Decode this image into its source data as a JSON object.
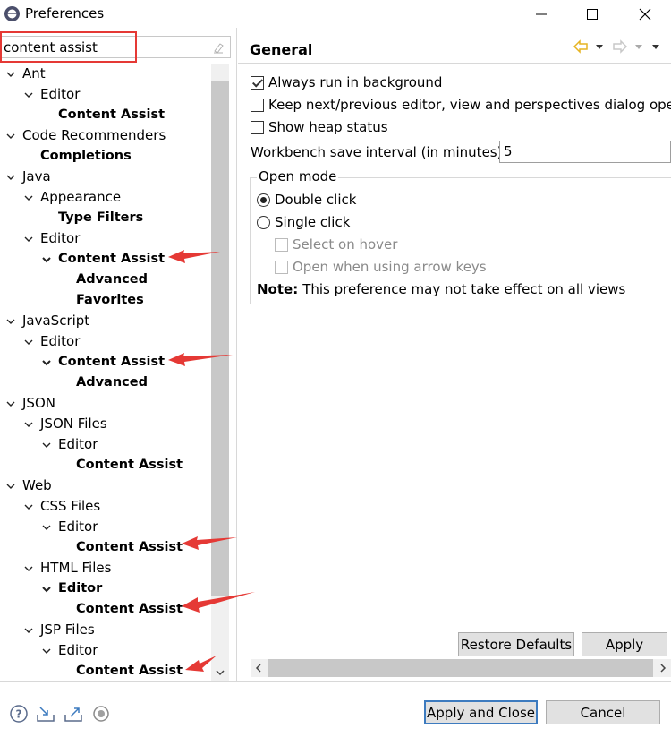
{
  "window": {
    "title": "Preferences"
  },
  "filter": {
    "value": "content assist"
  },
  "tree": [
    {
      "label": "Ant",
      "level": 0,
      "expanded": true,
      "bold": false
    },
    {
      "label": "Editor",
      "level": 1,
      "expanded": true,
      "bold": false
    },
    {
      "label": "Content Assist",
      "level": 2,
      "expanded": null,
      "bold": true
    },
    {
      "label": "Code Recommenders",
      "level": 0,
      "expanded": true,
      "bold": false
    },
    {
      "label": "Completions",
      "level": 1,
      "expanded": null,
      "bold": true
    },
    {
      "label": "Java",
      "level": 0,
      "expanded": true,
      "bold": false
    },
    {
      "label": "Appearance",
      "level": 1,
      "expanded": true,
      "bold": false
    },
    {
      "label": "Type Filters",
      "level": 2,
      "expanded": null,
      "bold": true
    },
    {
      "label": "Editor",
      "level": 1,
      "expanded": true,
      "bold": false
    },
    {
      "label": "Content Assist",
      "level": 2,
      "expanded": true,
      "bold": true
    },
    {
      "label": "Advanced",
      "level": 3,
      "expanded": null,
      "bold": true
    },
    {
      "label": "Favorites",
      "level": 3,
      "expanded": null,
      "bold": true
    },
    {
      "label": "JavaScript",
      "level": 0,
      "expanded": true,
      "bold": false
    },
    {
      "label": "Editor",
      "level": 1,
      "expanded": true,
      "bold": false
    },
    {
      "label": "Content Assist",
      "level": 2,
      "expanded": true,
      "bold": true
    },
    {
      "label": "Advanced",
      "level": 3,
      "expanded": null,
      "bold": true
    },
    {
      "label": "JSON",
      "level": 0,
      "expanded": true,
      "bold": false
    },
    {
      "label": "JSON Files",
      "level": 1,
      "expanded": true,
      "bold": false
    },
    {
      "label": "Editor",
      "level": 2,
      "expanded": true,
      "bold": false
    },
    {
      "label": "Content Assist",
      "level": 3,
      "expanded": null,
      "bold": true
    },
    {
      "label": "Web",
      "level": 0,
      "expanded": true,
      "bold": false
    },
    {
      "label": "CSS Files",
      "level": 1,
      "expanded": true,
      "bold": false
    },
    {
      "label": "Editor",
      "level": 2,
      "expanded": true,
      "bold": false
    },
    {
      "label": "Content Assist",
      "level": 3,
      "expanded": null,
      "bold": true
    },
    {
      "label": "HTML Files",
      "level": 1,
      "expanded": true,
      "bold": false
    },
    {
      "label": "Editor",
      "level": 2,
      "expanded": true,
      "bold": true
    },
    {
      "label": "Content Assist",
      "level": 3,
      "expanded": null,
      "bold": true
    },
    {
      "label": "JSP Files",
      "level": 1,
      "expanded": true,
      "bold": false
    },
    {
      "label": "Editor",
      "level": 2,
      "expanded": true,
      "bold": false
    },
    {
      "label": "Content Assist",
      "level": 3,
      "expanded": null,
      "bold": true
    }
  ],
  "general": {
    "title": "General",
    "always_run": {
      "label": "Always run in background",
      "checked": true
    },
    "keep_next": {
      "label": "Keep next/previous editor, view and perspectives dialog open",
      "checked": false
    },
    "show_heap": {
      "label": "Show heap status",
      "checked": false
    },
    "save_interval": {
      "label": "Workbench save interval (in minutes):",
      "value": "5"
    },
    "open_mode": {
      "label": "Open mode",
      "double_click": "Double click",
      "single_click": "Single click",
      "select_on_hover": "Select on hover",
      "open_arrow_keys": "Open when using arrow keys",
      "selected": "double"
    },
    "note_label": "Note:",
    "note_text": "This preference may not take effect on all views",
    "restore_defaults": "Restore Defaults",
    "apply": "Apply"
  },
  "footer": {
    "apply_close": "Apply and Close",
    "cancel": "Cancel"
  },
  "colors": {
    "annotation": "#e53935",
    "nav_arrow": "#e6b422"
  }
}
